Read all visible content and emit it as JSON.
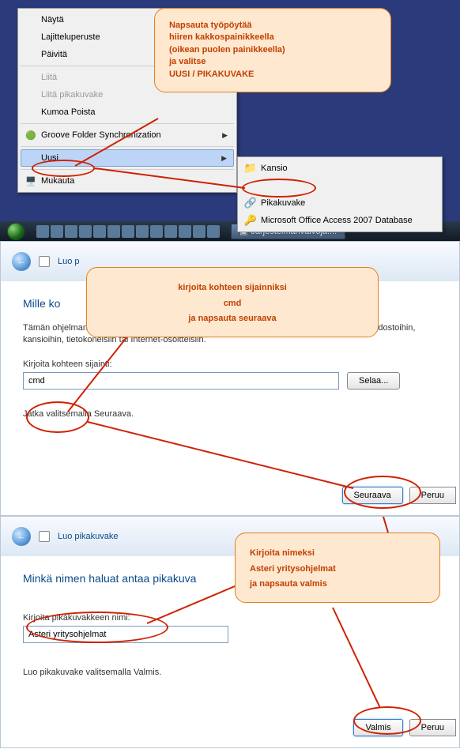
{
  "callout1": {
    "l1": "Napsauta työpöytää",
    "l2": "hiiren kakkospainikkeella",
    "l3": "(oikean puolen painikkeella)",
    "l4": "ja valitse",
    "l5": "UUSI / PIKAKUVAKE"
  },
  "ctxmenu": {
    "view": "Näytä",
    "sort": "Lajitteluperuste",
    "refresh": "Päivitä",
    "paste": "Liitä",
    "paste_shortcut": "Liitä pikakuvake",
    "undo": "Kumoa Poista",
    "groove": "Groove Folder Synchronization",
    "new": "Uusi",
    "personalize": "Mukauta"
  },
  "submenu": {
    "folder": "Kansio",
    "shortcut": "Pikakuvake",
    "access": "Microsoft Office Access 2007 Database"
  },
  "taskbar": {
    "task": "Järjestelmänvalvoja:..."
  },
  "callout2": {
    "l1": "kirjoita kohteen sijainniksi",
    "l2": "cmd",
    "l3": "ja napsauta seuraava"
  },
  "wiz1": {
    "title": "Luo p",
    "heading": "Mille ko",
    "desc": "Tämän ohjelman avulla voi luoda pikakuvakkeita paikallisiin tai verkossa oleviin ohjelmiin, tiedostoihin, kansioihin, tietokoneisiin tai Internet-osoitteisiin.",
    "label": "Kirjoita kohteen sijainti:",
    "value": "cmd",
    "browse": "Selaa...",
    "hint": "Jatka valitsemalla Seuraava.",
    "next": "Seuraava",
    "cancel": "Peruu"
  },
  "callout3": {
    "l1": "Kirjoita nimeksi",
    "l2": "Asteri yritysohjelmat",
    "l3": "ja napsauta valmis"
  },
  "wiz2": {
    "title": "Luo pikakuvake",
    "heading": "Minkä nimen haluat antaa pikakuva",
    "label": "Kirjoita pikakuvakkeen nimi:",
    "value": "Asteri yritysohjelmat",
    "hint": "Luo pikakuvake valitsemalla Valmis.",
    "finish": "Valmis",
    "cancel": "Peruu"
  }
}
